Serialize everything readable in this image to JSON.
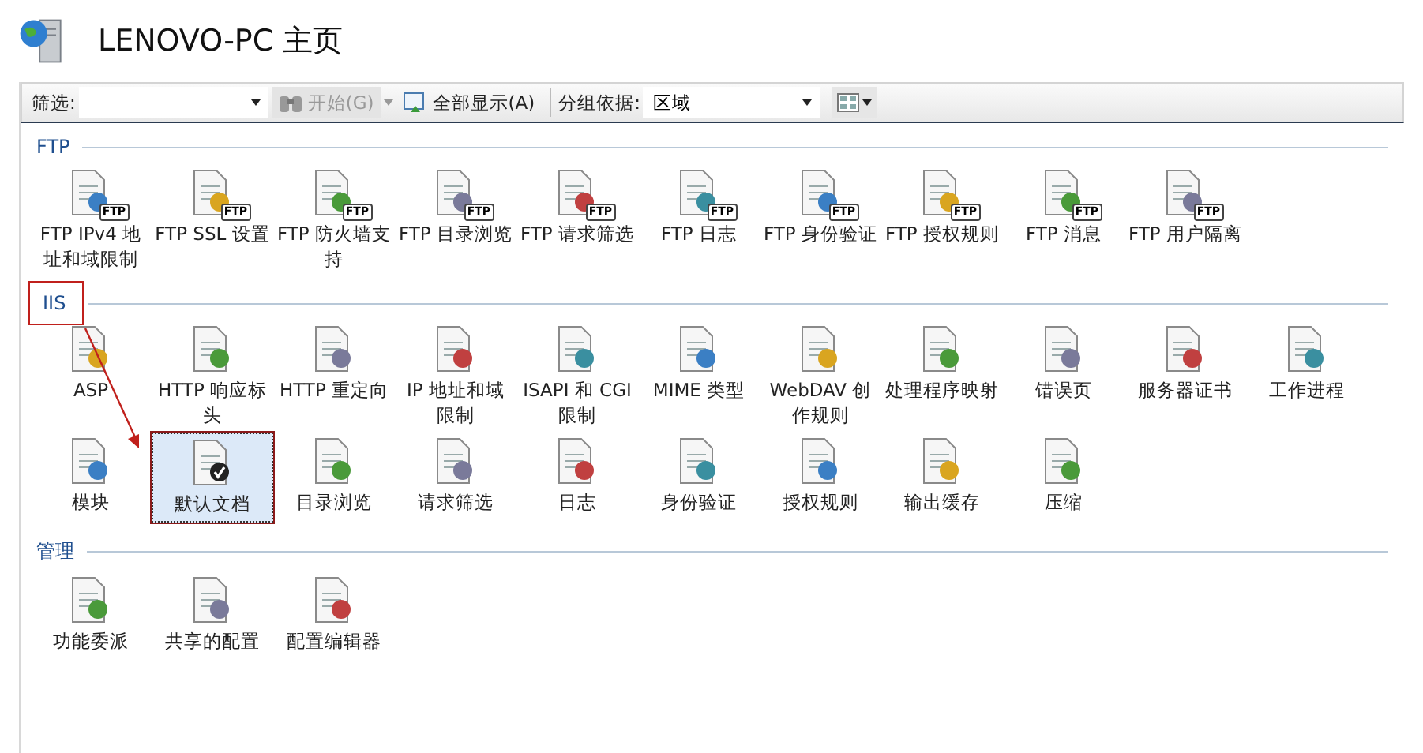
{
  "window": {
    "title": "LENOVO-PC 主页"
  },
  "toolbar": {
    "filter_label": "筛选:",
    "start_button": {
      "label": "开始(G)",
      "disabled": true
    },
    "show_all_button": {
      "label": "全部显示(A)",
      "disabled": false
    },
    "group_label": "分组依据:",
    "group_select": {
      "value": "区域"
    }
  },
  "sections": [
    {
      "title": "FTP",
      "annotated": false,
      "items": [
        {
          "label": "FTP IPv4 地址和域限制",
          "badge": "FTP",
          "selected": false
        },
        {
          "label": "FTP SSL 设置",
          "badge": "FTP",
          "selected": false
        },
        {
          "label": "FTP 防火墙支持",
          "badge": "FTP",
          "selected": false
        },
        {
          "label": "FTP 目录浏览",
          "badge": "FTP",
          "selected": false
        },
        {
          "label": "FTP 请求筛选",
          "badge": "FTP",
          "selected": false
        },
        {
          "label": "FTP 日志",
          "badge": "FTP",
          "selected": false
        },
        {
          "label": "FTP 身份验证",
          "badge": "FTP",
          "selected": false
        },
        {
          "label": "FTP 授权规则",
          "badge": "FTP",
          "selected": false
        },
        {
          "label": "FTP 消息",
          "badge": "FTP",
          "selected": false
        },
        {
          "label": "FTP 用户隔离",
          "badge": "FTP",
          "selected": false
        }
      ]
    },
    {
      "title": "IIS",
      "annotated": true,
      "items": [
        {
          "label": "ASP",
          "selected": false
        },
        {
          "label": "HTTP 响应标头",
          "selected": false
        },
        {
          "label": "HTTP 重定向",
          "selected": false
        },
        {
          "label": "IP 地址和域限制",
          "selected": false
        },
        {
          "label": "ISAPI 和 CGI 限制",
          "selected": false
        },
        {
          "label": "MIME 类型",
          "selected": false
        },
        {
          "label": "WebDAV 创作规则",
          "selected": false
        },
        {
          "label": "处理程序映射",
          "selected": false
        },
        {
          "label": "错误页",
          "selected": false
        },
        {
          "label": "服务器证书",
          "selected": false
        },
        {
          "label": "工作进程",
          "selected": false
        },
        {
          "label": "模块",
          "selected": false
        },
        {
          "label": "默认文档",
          "selected": true
        },
        {
          "label": "目录浏览",
          "selected": false
        },
        {
          "label": "请求筛选",
          "selected": false
        },
        {
          "label": "日志",
          "selected": false
        },
        {
          "label": "身份验证",
          "selected": false
        },
        {
          "label": "授权规则",
          "selected": false
        },
        {
          "label": "输出缓存",
          "selected": false
        },
        {
          "label": "压缩",
          "selected": false
        }
      ]
    },
    {
      "title": "管理",
      "annotated": false,
      "items": [
        {
          "label": "功能委派",
          "selected": false
        },
        {
          "label": "共享的配置",
          "selected": false
        },
        {
          "label": "配置编辑器",
          "selected": false
        }
      ]
    }
  ]
}
